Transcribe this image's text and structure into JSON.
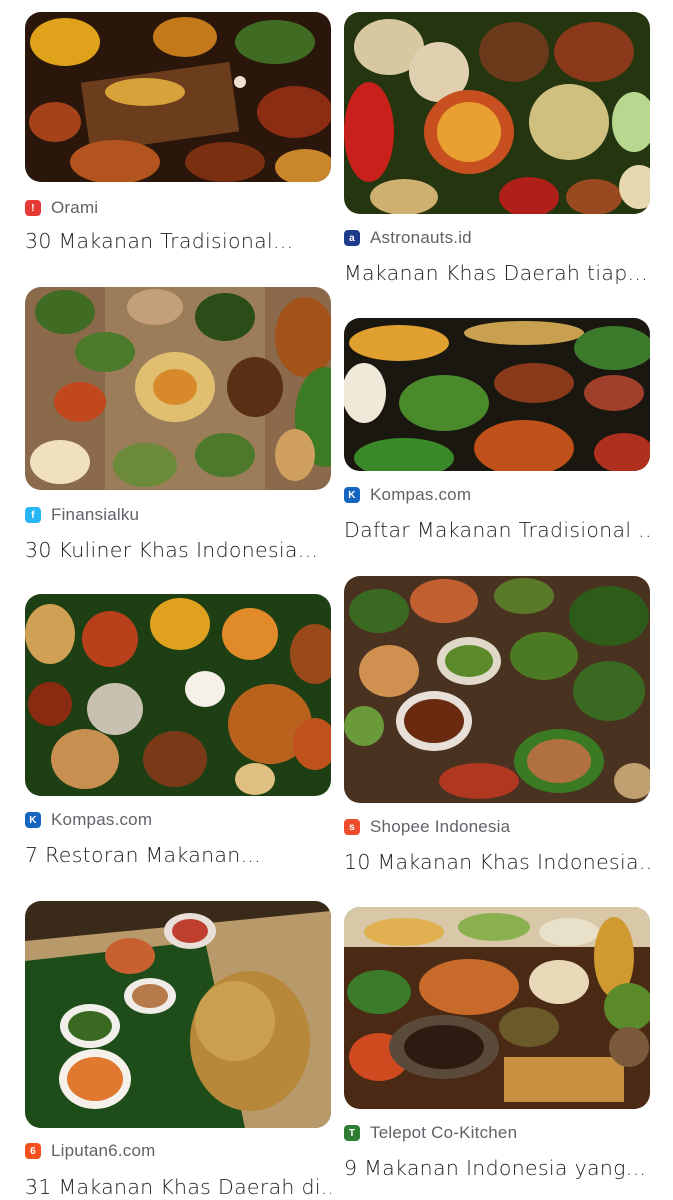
{
  "results": [
    {
      "source": "Orami",
      "title": "30 Makanan Tradisional...",
      "favicon_color": "#e53935",
      "favicon_glyph": "!",
      "favicon_icon": "orami-icon"
    },
    {
      "source": "Astronauts.id",
      "title": "Makanan Khas Daerah tiap...",
      "favicon_color": "#1e3a8a",
      "favicon_glyph": "a",
      "favicon_icon": "astronauts-icon"
    },
    {
      "source": "Finansialku",
      "title": "30 Kuliner Khas Indonesia...",
      "favicon_color": "#29b6f6",
      "favicon_glyph": "f",
      "favicon_icon": "finansialku-icon"
    },
    {
      "source": "Kompas.com",
      "title": "Daftar Makanan Tradisional ...",
      "favicon_color": "#1565c0",
      "favicon_glyph": "K",
      "favicon_icon": "kompas-icon"
    },
    {
      "source": "Kompas.com",
      "title": "7 Restoran Makanan...",
      "favicon_color": "#1565c0",
      "favicon_glyph": "K",
      "favicon_icon": "kompas-icon"
    },
    {
      "source": "Shopee Indonesia",
      "title": "10 Makanan Khas Indonesia...",
      "favicon_color": "#ee4d2d",
      "favicon_glyph": "s",
      "favicon_icon": "shopee-icon"
    },
    {
      "source": "Liputan6.com",
      "title": "31 Makanan Khas Daerah di...",
      "favicon_color": "#f4511e",
      "favicon_glyph": "6",
      "favicon_icon": "liputan6-icon"
    },
    {
      "source": "Telepot Co-Kitchen",
      "title": "9 Makanan Indonesia yang...",
      "favicon_color": "#2e7d32",
      "favicon_glyph": "T",
      "favicon_icon": "telepot-icon"
    }
  ]
}
